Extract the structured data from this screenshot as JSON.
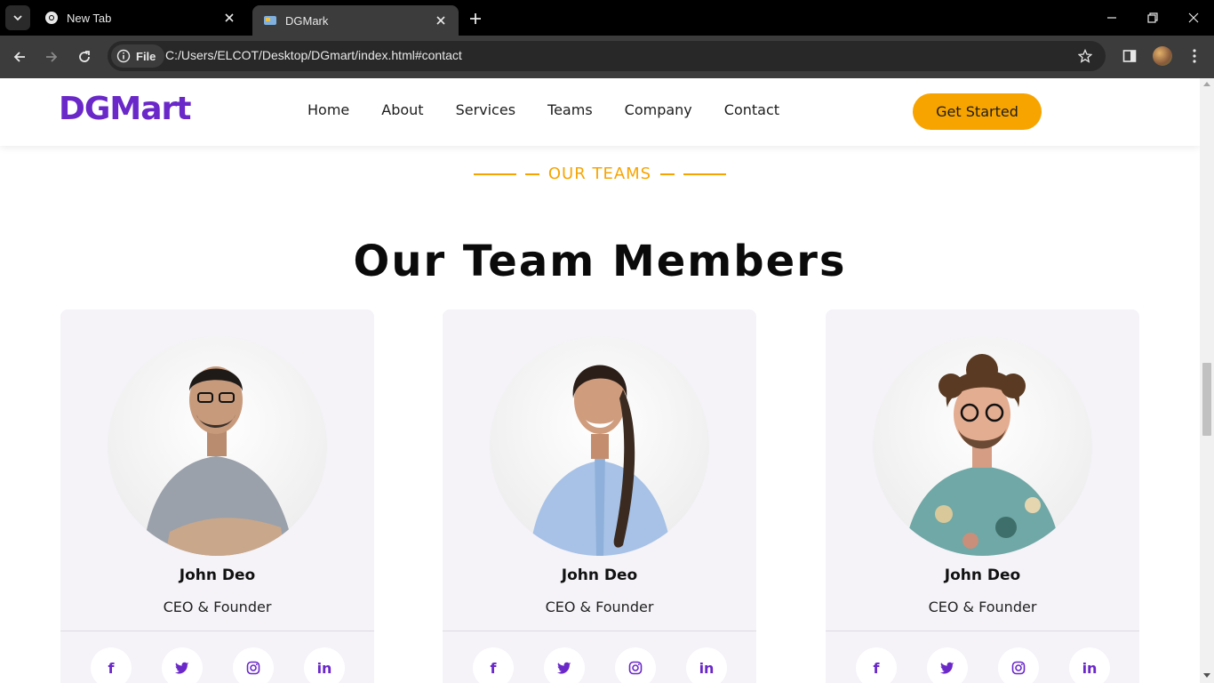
{
  "browser": {
    "tabs": [
      {
        "title": "New Tab"
      },
      {
        "title": "DGMark"
      }
    ],
    "site_chip": "File",
    "url": "C:/Users/ELCOT/Desktop/DGmart/index.html#contact"
  },
  "header": {
    "logo": "DGMart",
    "nav": [
      "Home",
      "About",
      "Services",
      "Teams",
      "Company",
      "Contact"
    ],
    "cta": "Get Started"
  },
  "section": {
    "eyebrow": "OUR TEAMS",
    "title": "Our Team Members"
  },
  "team": [
    {
      "name": "John Deo",
      "role": "CEO & Founder"
    },
    {
      "name": "John Deo",
      "role": "CEO & Founder"
    },
    {
      "name": "John Deo",
      "role": "CEO & Founder"
    }
  ],
  "social_icons": [
    "facebook-icon",
    "twitter-icon",
    "instagram-icon",
    "linkedin-icon"
  ],
  "colors": {
    "brand": "#6a28c9",
    "accent": "#f7a400",
    "card_bg": "#f5f2f8"
  }
}
